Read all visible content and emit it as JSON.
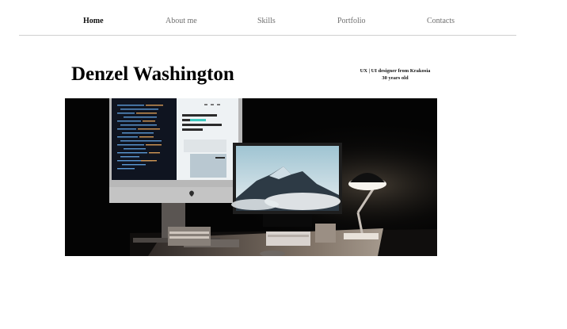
{
  "nav": {
    "items": [
      {
        "label": "Home",
        "active": true
      },
      {
        "label": "About me",
        "active": false
      },
      {
        "label": "Skills",
        "active": false
      },
      {
        "label": "Portfolio",
        "active": false
      },
      {
        "label": "Contacts",
        "active": false
      }
    ]
  },
  "hero": {
    "name": "Denzel Washington",
    "tagline_line1": "UX | UI designer from Krakosia",
    "tagline_line2": "30 years old"
  },
  "image": {
    "icon": "desk-workspace-photo",
    "background": "#050505"
  }
}
